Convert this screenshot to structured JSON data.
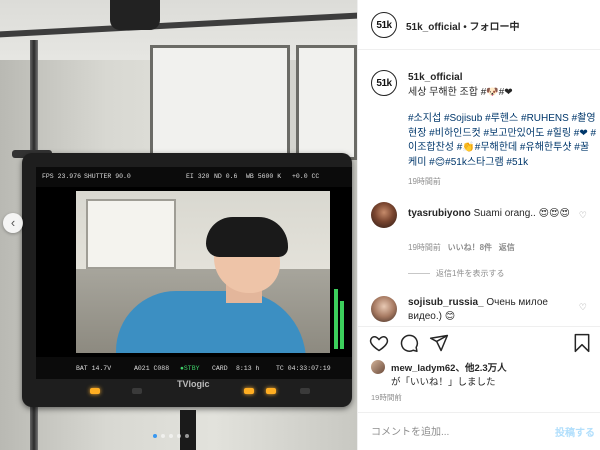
{
  "colors": {
    "link": "#00376b",
    "accent": "#3897f0",
    "muted": "#8e8e8e",
    "post_disabled": "#b2dffc"
  },
  "photo": {
    "monitor": {
      "brand": "TVlogic",
      "hud_top": {
        "fps": "FPS 23.976",
        "shutter": "SHUTTER 90.0",
        "ei": "EI 320",
        "nd": "ND 0.6",
        "wb": "WB 5600 K",
        "tint": "+0.0 CC"
      },
      "hud_bottom": {
        "battery": "BAT 14.7V",
        "media": "A021 C088",
        "status": "●STBY",
        "card": "CARD",
        "remaining": "8:13 h",
        "tc": "TC 04:33:07:19"
      }
    },
    "carousel": {
      "prev_icon": "chevron-left-icon",
      "prev_glyph": "‹",
      "dot_count": 5,
      "active_index": 0
    }
  },
  "header": {
    "avatar_text": "51k",
    "username": "51k_official",
    "separator": " • ",
    "follow_status": "フォロー中"
  },
  "caption": {
    "avatar_text": "51k",
    "username": "51k_official",
    "text": "세상 무해한 조합 #🐶#❤",
    "hashtags": "#소지섭 #Sojisub #루헨스 #RUHENS #촬영현장 #비하인드컷 #보고만있어도 #힐링 #❤ #이조합찬성 #👏#무해한데 #유해한투샷 #꿀케미 #😊#51k스타그램 #51k",
    "time": "19時間前"
  },
  "comments": [
    {
      "username": "tyasrubiyono",
      "text": "Suami orang.. 😍😍😍",
      "time": "19時間前",
      "likes": "いいね！8件",
      "reply": "返信",
      "view_replies": "返信1件を表示する"
    },
    {
      "username": "sojisub_russia_",
      "text": "Очень милое видео.) 😊"
    }
  ],
  "actions": {
    "like_icon": "heart-icon",
    "comment_icon": "comment-icon",
    "share_icon": "share-icon",
    "save_icon": "bookmark-icon"
  },
  "likes": {
    "prefix": "mew_ladym62",
    "suffix": "、他2.3万人",
    "line2": "が「いいね！」しました"
  },
  "post_time": "19時間前",
  "comment_box": {
    "placeholder": "コメントを追加...",
    "post_label": "投稿する"
  }
}
